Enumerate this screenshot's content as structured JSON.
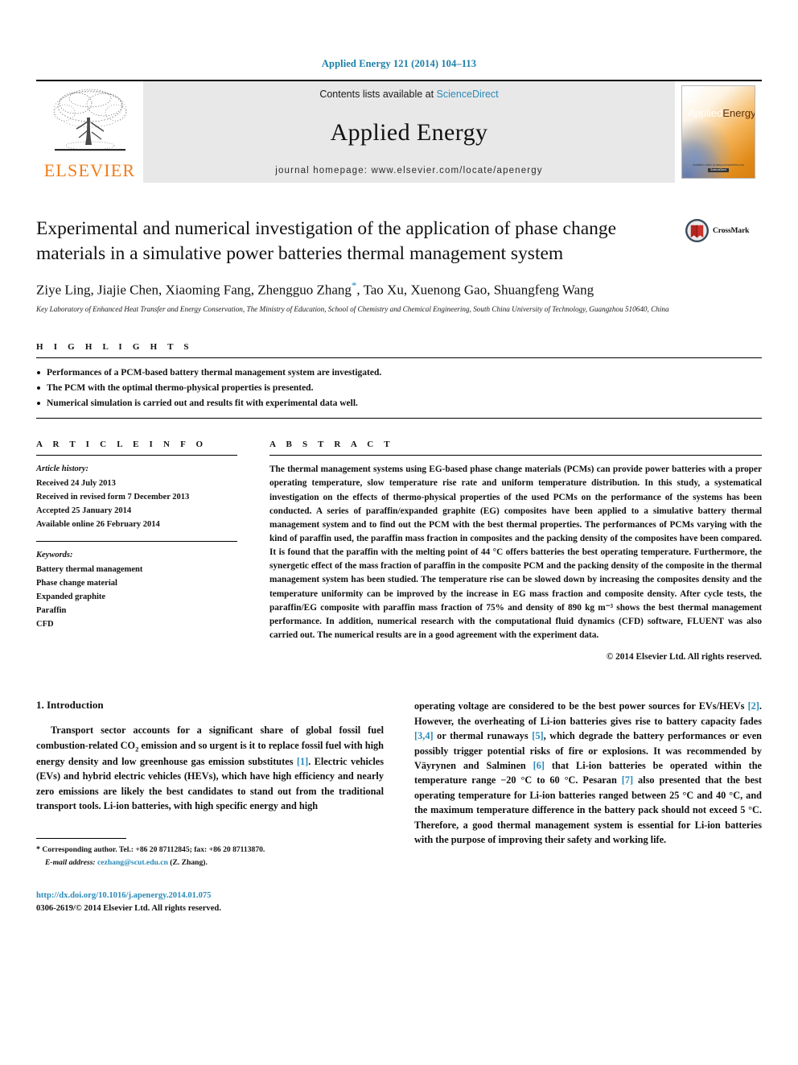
{
  "running_head": "Applied Energy 121 (2014) 104–113",
  "masthead": {
    "contents_prefix": "Contents lists available at ",
    "sciencedirect": "ScienceDirect",
    "journal_title": "Applied Energy",
    "homepage": "journal homepage: www.elsevier.com/locate/apenergy",
    "publisher": "ELSEVIER",
    "cover": {
      "title_a": "Applied",
      "title_b": "Energy",
      "footer_line1": "Available online at www.sciencedirect.com",
      "footer_badge": "ScienceDirect"
    }
  },
  "article": {
    "title": "Experimental and numerical investigation of the application of phase change materials in a simulative power batteries thermal management system",
    "crossmark_label": "CrossMark",
    "authors": "Ziye Ling, Jiajie Chen, Xiaoming Fang, Zhengguo Zhang",
    "authors_star": "*",
    "authors_tail": ", Tao Xu, Xuenong Gao, Shuangfeng Wang",
    "affiliation": "Key Laboratory of Enhanced Heat Transfer and Energy Conservation, The Ministry of Education, School of Chemistry and Chemical Engineering, South China University of Technology, Guangzhou 510640, China"
  },
  "highlights": {
    "heading": "H I G H L I G H T S",
    "items": [
      "Performances of a PCM-based battery thermal management system are investigated.",
      "The PCM with the optimal thermo-physical properties is presented.",
      "Numerical simulation is carried out and results fit with experimental data well."
    ]
  },
  "article_info": {
    "heading": "A R T I C L E   I N F O",
    "history_label": "Article history:",
    "history": [
      "Received 24 July 2013",
      "Received in revised form 7 December 2013",
      "Accepted 25 January 2014",
      "Available online 26 February 2014"
    ],
    "keywords_label": "Keywords:",
    "keywords": [
      "Battery thermal management",
      "Phase change material",
      "Expanded graphite",
      "Paraffin",
      "CFD"
    ]
  },
  "abstract": {
    "heading": "A B S T R A C T",
    "text": "The thermal management systems using EG-based phase change materials (PCMs) can provide power batteries with a proper operating temperature, slow temperature rise rate and uniform temperature distribution. In this study, a systematical investigation on the effects of thermo-physical properties of the used PCMs on the performance of the systems has been conducted. A series of paraffin/expanded graphite (EG) composites have been applied to a simulative battery thermal management system and to find out the PCM with the best thermal properties. The performances of PCMs varying with the kind of paraffin used, the paraffin mass fraction in composites and the packing density of the composites have been compared. It is found that the paraffin with the melting point of 44 °C offers batteries the best operating temperature. Furthermore, the synergetic effect of the mass fraction of paraffin in the composite PCM and the packing density of the composite in the thermal management system has been studied. The temperature rise can be slowed down by increasing the composites density and the temperature uniformity can be improved by the increase in EG mass fraction and composite density. After cycle tests, the paraffin/EG composite with paraffin mass fraction of 75% and density of 890 kg m⁻³ shows the best thermal management performance. In addition, numerical research with the computational fluid dynamics (CFD) software, FLUENT was also carried out. The numerical results are in a good agreement with the experiment data.",
    "copyright": "© 2014 Elsevier Ltd. All rights reserved."
  },
  "introduction": {
    "heading": "1. Introduction",
    "left_paragraph_parts": {
      "p1": "Transport sector accounts for a significant share of global fossil fuel combustion-related CO",
      "p1_sub": "2",
      "p2": " emission and so urgent is it to replace fossil fuel with high energy density and low greenhouse gas emission substitutes ",
      "r1": "[1]",
      "p3": ". Electric vehicles (EVs) and hybrid electric vehicles (HEVs), which have high efficiency and nearly zero emissions are likely the best candidates to stand out from the traditional transport tools. Li-ion batteries, with high specific energy and high"
    },
    "right_paragraph_parts": {
      "p1": "operating voltage are considered to be the best power sources for EVs/HEVs ",
      "r1": "[2]",
      "p2": ". However, the overheating of Li-ion batteries gives rise to battery capacity fades ",
      "r2": "[3,4]",
      "p3": " or thermal runaways ",
      "r3": "[5]",
      "p4": ", which degrade the battery performances or even possibly trigger potential risks of fire or explosions. It was recommended by Väyrynen and Salminen ",
      "r4": "[6]",
      "p5": " that Li-ion batteries be operated within the temperature range −20 °C to 60 °C. Pesaran ",
      "r5": "[7]",
      "p6": " also presented that the best operating temperature for Li-ion batteries ranged between 25 °C and 40 °C, and the maximum temperature difference in the battery pack should not exceed 5 °C. Therefore, a good thermal management system is essential for Li-ion batteries with the purpose of improving their safety and working life."
    }
  },
  "footnote": {
    "star": "*",
    "corresponding": " Corresponding author. Tel.: +86 20 87112845; fax: +86 20 87113870.",
    "email_label": "E-mail address:",
    "email": "cezhang@scut.edu.cn",
    "email_tail": " (Z. Zhang)."
  },
  "doi_block": {
    "doi": "http://dx.doi.org/10.1016/j.apenergy.2014.01.075",
    "issn": "0306-2619/© 2014 Elsevier Ltd. All rights reserved."
  },
  "colors": {
    "link": "#2b8ab8",
    "elsevier_orange": "#f07d1a",
    "masthead_bg": "#e8e8e8"
  }
}
